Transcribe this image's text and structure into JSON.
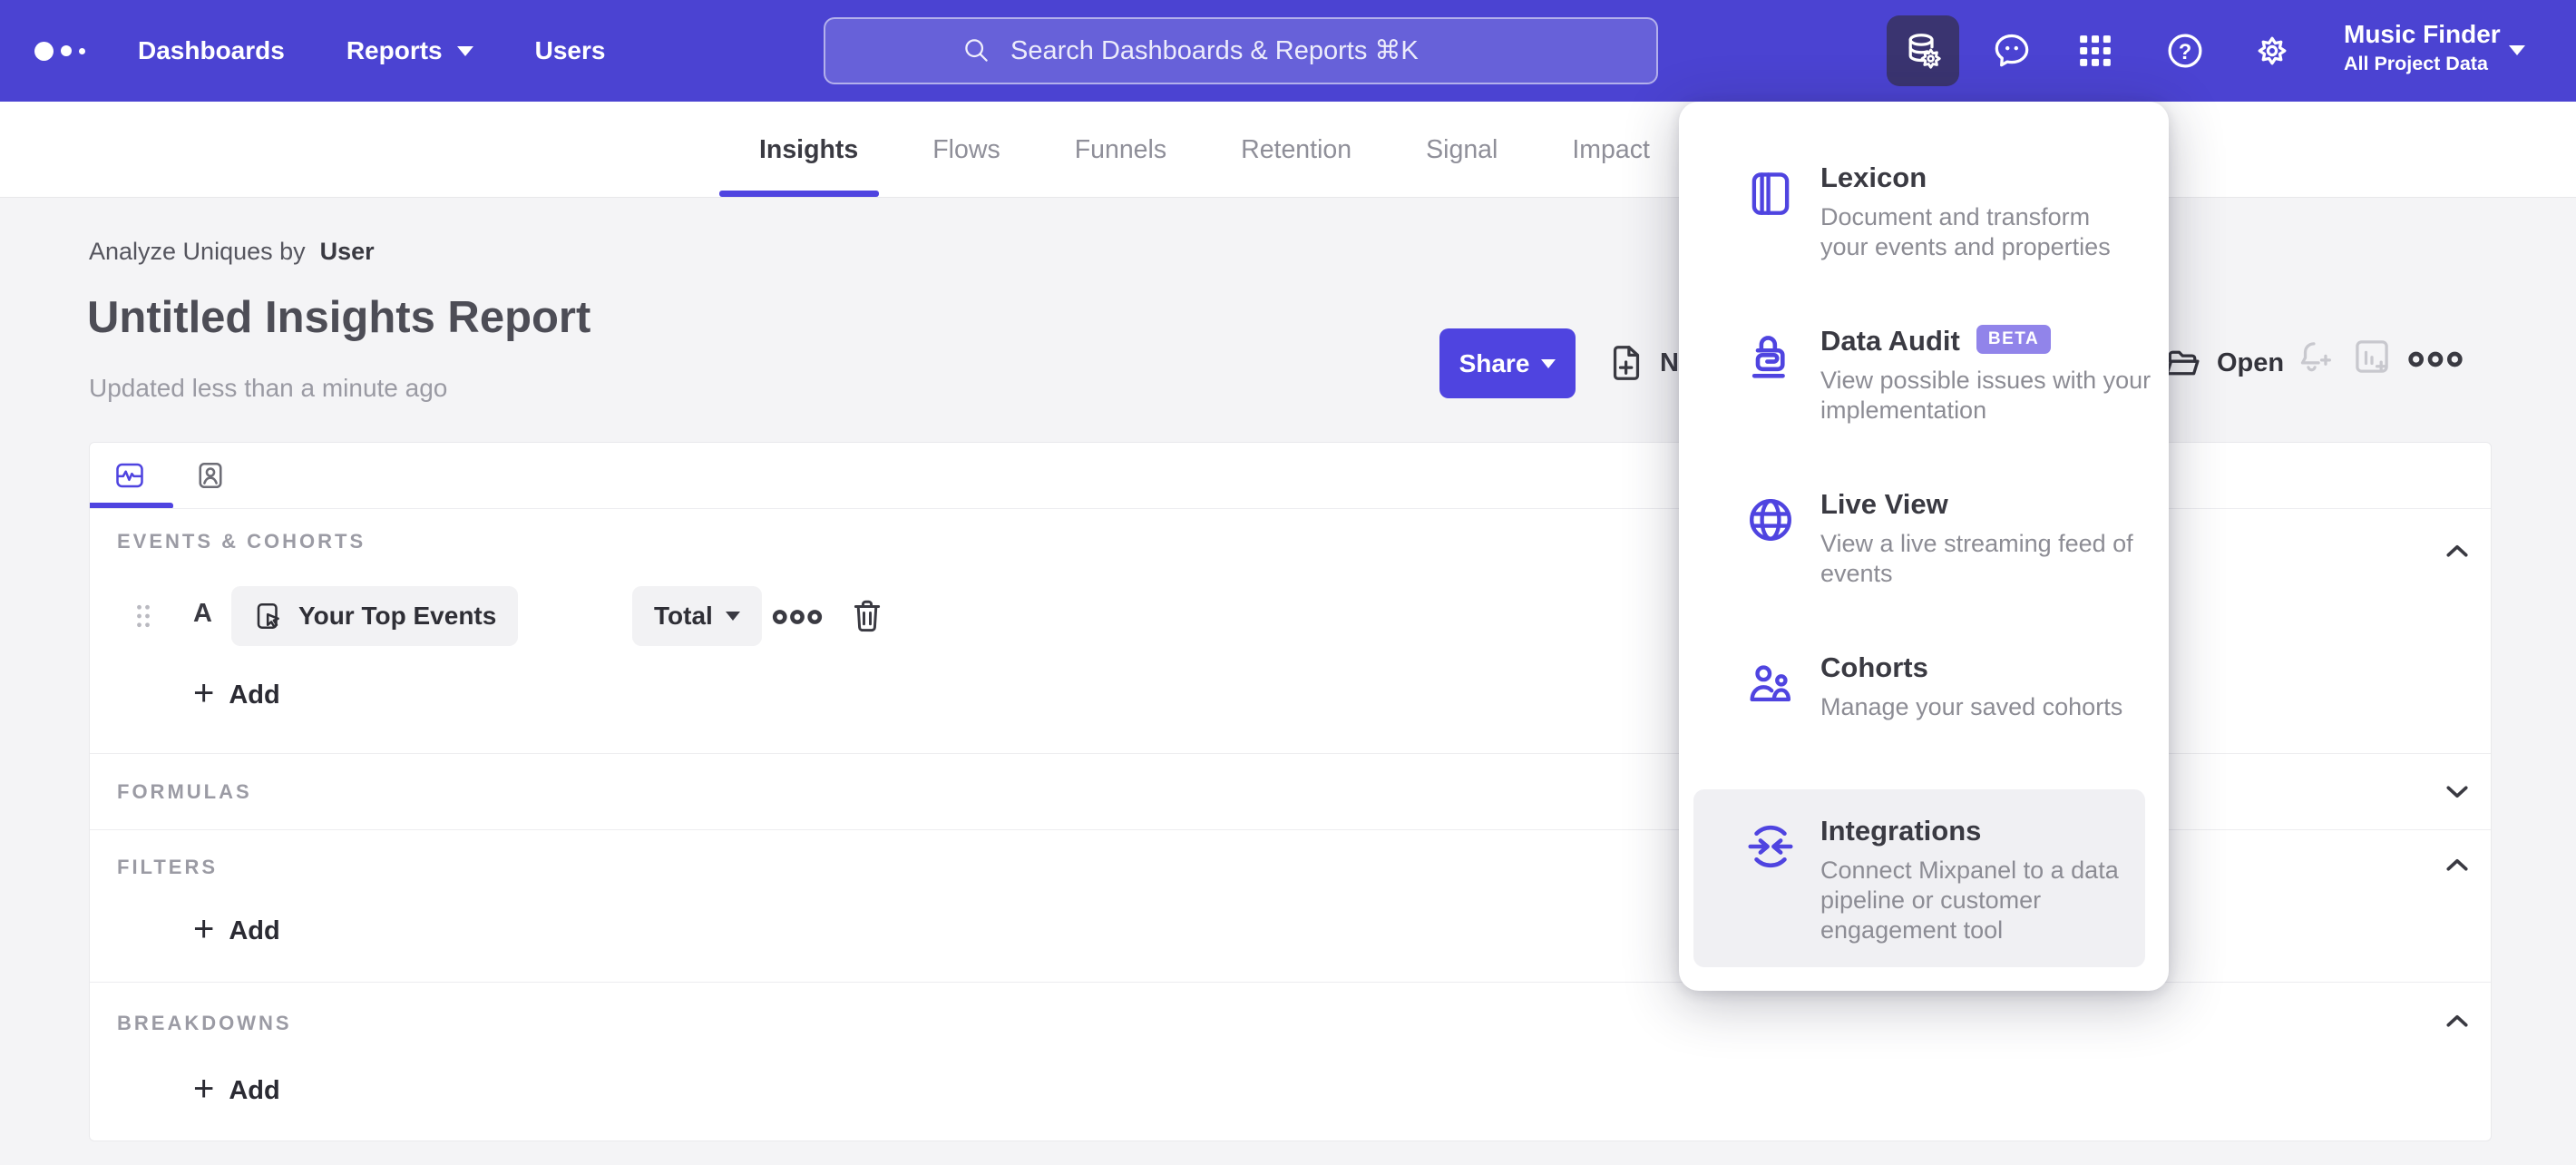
{
  "navbar": {
    "logo_icon": "mixpanel-logo-dots",
    "links": [
      "Dashboards",
      "Reports",
      "Users"
    ],
    "search": {
      "icon": "search-icon",
      "placeholder": "Search Dashboards & Reports ⌘K"
    },
    "action_icons": [
      "data-management-icon",
      "feedback-icon",
      "apps-grid-icon",
      "help-icon",
      "settings-gear-icon"
    ],
    "active_icon": "data-management-icon",
    "project": {
      "name": "Music Finder",
      "scope": "All Project Data"
    }
  },
  "tabs": {
    "items": [
      "Insights",
      "Flows",
      "Funnels",
      "Retention",
      "Signal",
      "Impact"
    ],
    "active": "Insights"
  },
  "report_header": {
    "analyze_label": "Analyze Uniques by",
    "analyze_value": "User",
    "title": "Untitled Insights Report",
    "updated": "Updated less than a minute ago",
    "share_button": "Share",
    "new_button": "New",
    "open_button": "Open",
    "right_icons": [
      "bell-plus-icon",
      "board-plus-icon",
      "ellipsis-icon"
    ]
  },
  "builder": {
    "view_tabs": [
      "insights-pulse-tab",
      "profiles-tab"
    ],
    "events_section": {
      "label": "EVENTS & COHORTS",
      "row_letter": "A",
      "event_name": "Your Top Events",
      "metric": "Total",
      "add_label": "Add",
      "collapse": "up"
    },
    "formulas_section": {
      "label": "FORMULAS",
      "collapse": "down"
    },
    "filters_section": {
      "label": "FILTERS",
      "add_label": "Add",
      "collapse": "up"
    },
    "breakdowns_section": {
      "label": "BREAKDOWNS",
      "add_label": "Add",
      "collapse": "up"
    }
  },
  "data_menu": {
    "items": [
      {
        "icon": "lexicon-book-icon",
        "title": "Lexicon",
        "desc": "Document and transform\nyour events and properties"
      },
      {
        "icon": "data-audit-lock-icon",
        "title": "Data Audit",
        "badge": "BETA",
        "desc": "View possible issues with your\nimplementation"
      },
      {
        "icon": "live-view-globe-icon",
        "title": "Live View",
        "desc": "View a live streaming feed of\nevents"
      },
      {
        "icon": "cohorts-people-icon",
        "title": "Cohorts",
        "desc": "Manage your saved cohorts"
      },
      {
        "icon": "integrations-sync-icon",
        "title": "Integrations",
        "desc": "Connect Mixpanel to a data\npipeline or customer\nengagement tool",
        "highlighted": true
      }
    ]
  },
  "colors": {
    "navbar": "#4b43d2",
    "accent": "#4f44e0",
    "active_icon_bg": "#3a3470",
    "beta_badge": "#9184ea",
    "page_bg": "#f4f4f6"
  }
}
